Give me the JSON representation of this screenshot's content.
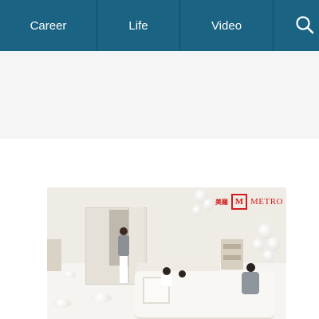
{
  "nav": {
    "items": [
      {
        "label": "Career"
      },
      {
        "label": "Life"
      },
      {
        "label": "Video"
      }
    ],
    "search_icon": "search-icon",
    "colors": {
      "background": "#1a6382",
      "divider": "#0f4b66",
      "text": "#ffffff"
    }
  },
  "banner_area": {
    "background": "#f5f5f5"
  },
  "advert": {
    "brand_chinese": "美羅",
    "brand_logo_letter": "M",
    "brand_name": "METRO",
    "brand_color": "#d21d1d"
  }
}
